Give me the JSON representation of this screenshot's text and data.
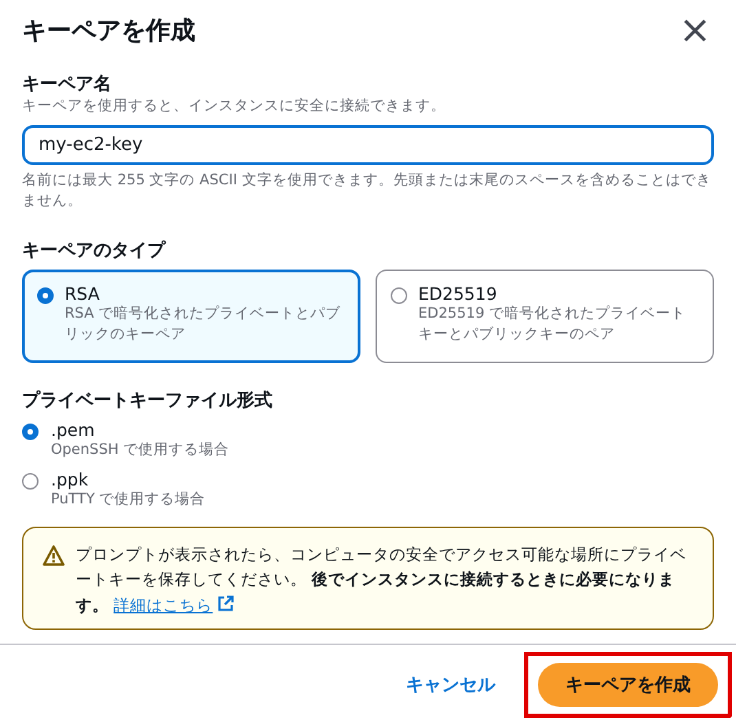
{
  "dialog": {
    "title": "キーペアを作成",
    "close": "×"
  },
  "key_name": {
    "label": "キーペア名",
    "description": "キーペアを使用すると、インスタンスに安全に接続できます。",
    "value": "my-ec2-key",
    "constraint": "名前には最大 255 文字の ASCII 文字を使用できます。先頭または末尾のスペースを含めることはできません。"
  },
  "key_type": {
    "label": "キーペアのタイプ",
    "options": [
      {
        "title": "RSA",
        "description": "RSA で暗号化されたプライベートとパブリックのキーペア",
        "selected": true
      },
      {
        "title": "ED25519",
        "description": "ED25519 で暗号化されたプライベートキーとパブリックキーのペア",
        "selected": false
      }
    ]
  },
  "file_format": {
    "label": "プライベートキーファイル形式",
    "options": [
      {
        "title": ".pem",
        "description": "OpenSSH で使用する場合",
        "selected": true
      },
      {
        "title": ".ppk",
        "description": "PuTTY で使用する場合",
        "selected": false
      }
    ]
  },
  "warning": {
    "text": "プロンプトが表示されたら、コンピュータの安全でアクセス可能な場所にプライベートキーを保存してください。 **後でインスタンスに接続するときに必要になります。**",
    "link": "詳細はこちら"
  },
  "buttons": [
    {
      "label": "キャンセル",
      "kind": "link",
      "highlighted": false
    },
    {
      "label": "キーペアを作成",
      "kind": "primary",
      "highlighted": true
    }
  ]
}
